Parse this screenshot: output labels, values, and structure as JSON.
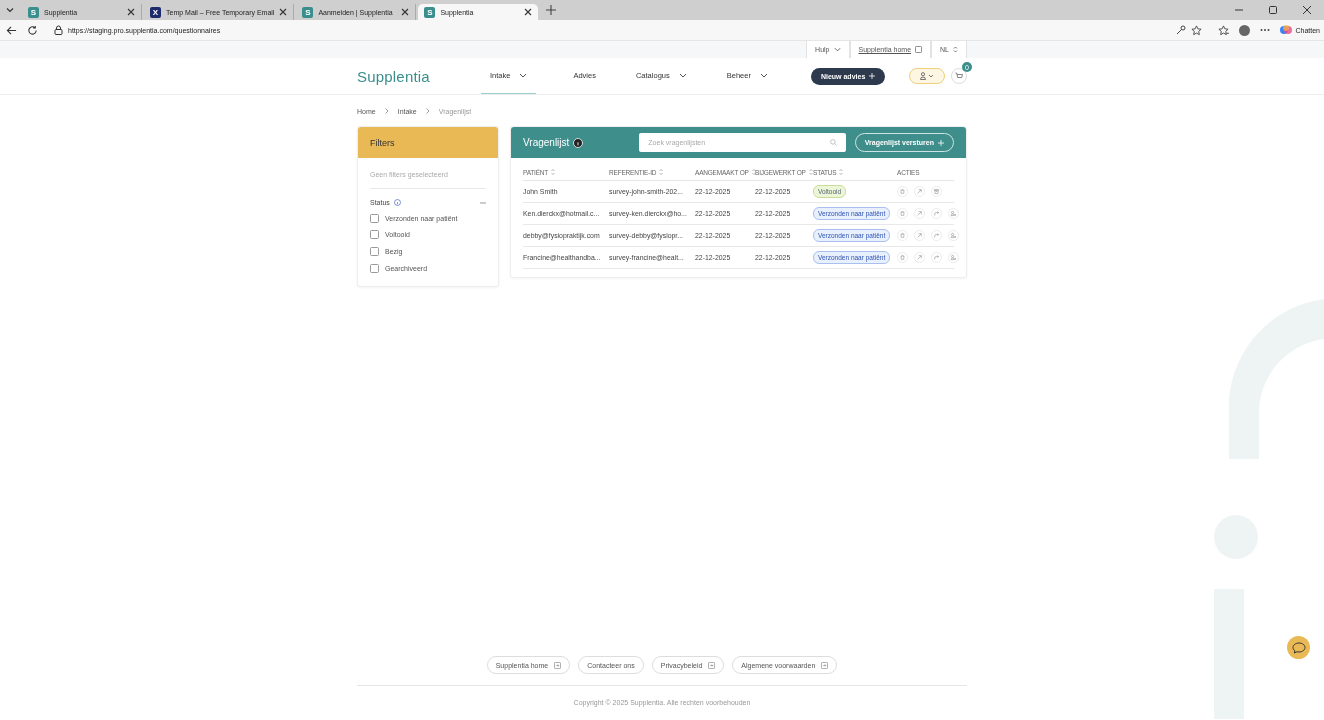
{
  "browser": {
    "tabs": [
      {
        "favicon": "S",
        "color": "#3a8f8c",
        "title": "Supplentia",
        "selected": false
      },
      {
        "favicon": "X",
        "color": "#1d2a6b",
        "title": "Temp Mail – Free Temporary Email",
        "selected": false
      },
      {
        "favicon": "S",
        "color": "#3a8f8c",
        "title": "Aanmelden | Supplentia",
        "selected": false
      },
      {
        "favicon": "S",
        "color": "#3a8f8c",
        "title": "Supplentia",
        "selected": true
      }
    ],
    "url": "https://staging.pro.supplentia.com/questionnaires",
    "copilot_label": "Chatten"
  },
  "utility_bar": {
    "help": "Hulp",
    "home_link": "Supplentia home",
    "language": "NL"
  },
  "header": {
    "logo": "Supplentia",
    "nav": [
      {
        "label": "Intake",
        "dropdown": true,
        "selected": true
      },
      {
        "label": "Advies",
        "dropdown": false,
        "selected": false
      },
      {
        "label": "Catalogus",
        "dropdown": true,
        "selected": false
      },
      {
        "label": "Beheer",
        "dropdown": true,
        "selected": false
      }
    ],
    "new_button": "Nieuw advies",
    "cart_count": "0"
  },
  "breadcrumb": [
    "Home",
    "Intake",
    "Vragenlijst"
  ],
  "filters": {
    "title": "Filters",
    "empty_note": "Geen filters geselecteerd",
    "group": "Status",
    "options": [
      {
        "label": "Verzonden naar patiënt",
        "checked": false
      },
      {
        "label": "Voltooid",
        "checked": false
      },
      {
        "label": "Bezig",
        "checked": false
      },
      {
        "label": "Gearchiveerd",
        "checked": false
      }
    ]
  },
  "questionnaires": {
    "title": "Vragenlijst",
    "search_placeholder": "Zoek vragenlijsten",
    "send_button": "Vragenlijst versturen",
    "columns": [
      {
        "label": "PATIËNT",
        "sortable": true
      },
      {
        "label": "REFERENTIE-ID",
        "sortable": true
      },
      {
        "label": "AANGEMAAKT OP",
        "sortable": true
      },
      {
        "label": "BIJGEWERKT OP",
        "sortable": true
      },
      {
        "label": "STATUS",
        "sortable": true
      },
      {
        "label": "ACTIES",
        "sortable": false
      }
    ],
    "rows": [
      {
        "patient": "John Smith",
        "reference": "survey-john-smith-202...",
        "created": "22-12-2025",
        "updated": "22-12-2025",
        "status": {
          "kind": "completed",
          "label": "Voltooid"
        }
      },
      {
        "patient": "Ken.dierckx@hotmail.c...",
        "reference": "survey-ken.dierckx@ho...",
        "created": "22-12-2025",
        "updated": "22-12-2025",
        "status": {
          "kind": "sent",
          "label": "Verzonden naar patiënt"
        }
      },
      {
        "patient": "debby@fysiopraktijk.com",
        "reference": "survey-debby@fysiopr...",
        "created": "22-12-2025",
        "updated": "22-12-2025",
        "status": {
          "kind": "sent",
          "label": "Verzonden naar patiënt"
        }
      },
      {
        "patient": "Francine@healthandba...",
        "reference": "survey-francine@healt...",
        "created": "22-12-2025",
        "updated": "22-12-2025",
        "status": {
          "kind": "sent",
          "label": "Verzonden naar patiënt"
        }
      }
    ]
  },
  "footer": {
    "links": [
      {
        "label": "Supplentia home",
        "external": true
      },
      {
        "label": "Contacteer ons",
        "external": false
      },
      {
        "label": "Privacybeleid",
        "external": true
      },
      {
        "label": "Algemene voorwaarden",
        "external": true
      }
    ],
    "copyright": "Copyright © 2025 Supplentia. Alle rechten voorbehouden"
  }
}
